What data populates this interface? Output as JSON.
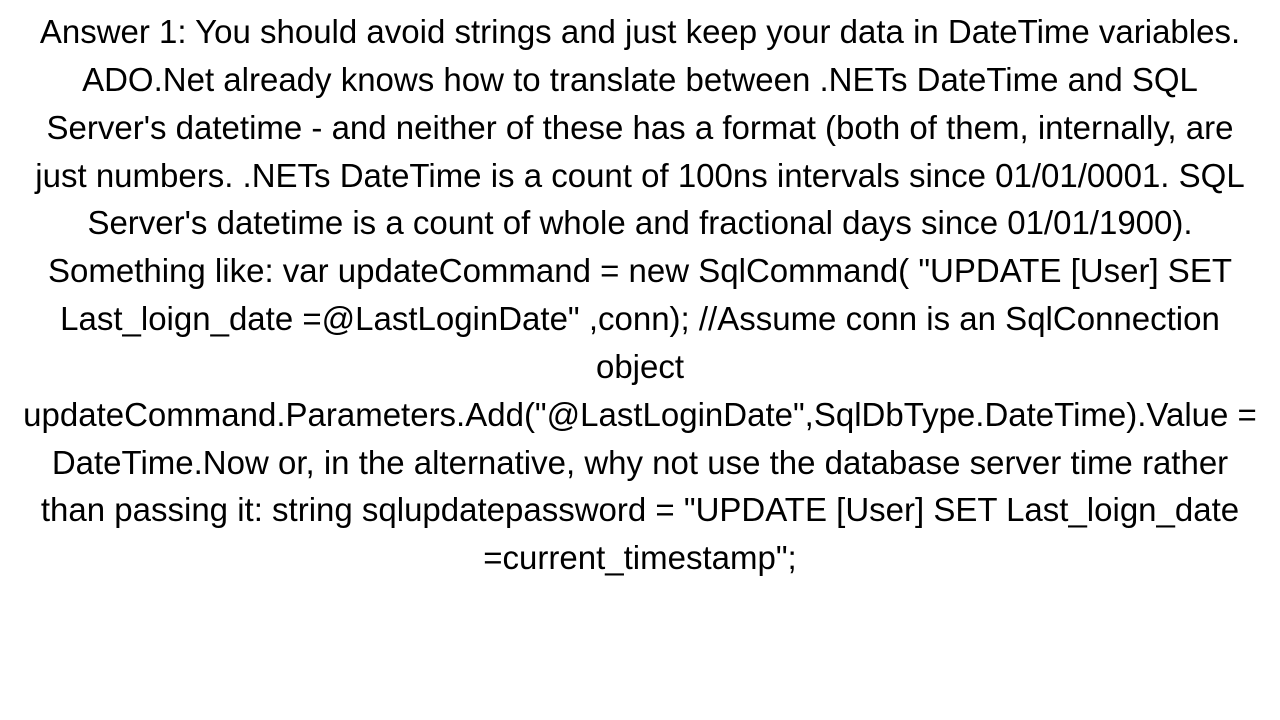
{
  "answer": {
    "text": "Answer 1: You should avoid strings and just keep your data in DateTime variables. ADO.Net already knows how to translate between .NETs DateTime and SQL Server's datetime - and neither of these has a format (both of them, internally, are just numbers. .NETs DateTime is a count of 100ns intervals since 01/01/0001. SQL Server's datetime is a count of whole and fractional days since 01/01/1900). Something like: var updateCommand = new SqlCommand(          \"UPDATE  [User] SET  Last_loign_date =@LastLoginDate\"          ,conn); //Assume conn is an SqlConnection object updateCommand.Parameters.Add(\"@LastLoginDate\",SqlDbType.DateTime).Value = DateTime.Now  or, in the alternative, why not use the database server time rather than passing it: string sqlupdatepassword = \"UPDATE  [User] SET  Last_loign_date =current_timestamp\";"
  }
}
